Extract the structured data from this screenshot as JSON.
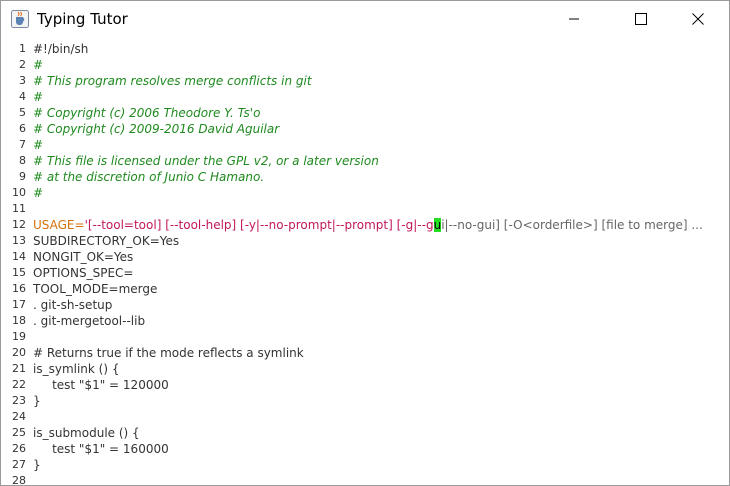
{
  "window": {
    "title": "Typing Tutor",
    "icons": {
      "app": "java-cup-icon",
      "minimize": "minimize-icon",
      "maximize": "maximize-icon",
      "close": "close-icon"
    }
  },
  "editor": {
    "lines": [
      {
        "n": "1",
        "t": "#!/bin/sh",
        "kind": "plain"
      },
      {
        "n": "2",
        "t": "#",
        "kind": "comment"
      },
      {
        "n": "3",
        "t": "# This program resolves merge conflicts in git",
        "kind": "comment"
      },
      {
        "n": "4",
        "t": "#",
        "kind": "comment"
      },
      {
        "n": "5",
        "t": "# Copyright (c) 2006 Theodore Y. Ts'o",
        "kind": "comment"
      },
      {
        "n": "6",
        "t": "# Copyright (c) 2009-2016 David Aguilar",
        "kind": "comment"
      },
      {
        "n": "7",
        "t": "#",
        "kind": "comment"
      },
      {
        "n": "8",
        "t": "# This file is licensed under the GPL v2, or a later version",
        "kind": "comment"
      },
      {
        "n": "9",
        "t": "# at the discretion of Junio C Hamano.",
        "kind": "comment"
      },
      {
        "n": "10",
        "t": "#",
        "kind": "comment"
      },
      {
        "n": "11",
        "t": "",
        "kind": "plain"
      },
      {
        "n": "12",
        "kind": "usage",
        "parts": {
          "var": "USAGE=",
          "str": "'[--tool=tool] [--tool-help] [-y|--no-prompt|--prompt] [-g|--g",
          "cursor": "u",
          "rest": "i|--no-gui] [-O<orderfile>] [file to merge] ..."
        }
      },
      {
        "n": "13",
        "t": "SUBDIRECTORY_OK=Yes",
        "kind": "plain"
      },
      {
        "n": "14",
        "t": "NONGIT_OK=Yes",
        "kind": "plain"
      },
      {
        "n": "15",
        "t": "OPTIONS_SPEC=",
        "kind": "plain"
      },
      {
        "n": "16",
        "t": "TOOL_MODE=merge",
        "kind": "plain"
      },
      {
        "n": "17",
        "t": ". git-sh-setup",
        "kind": "plain"
      },
      {
        "n": "18",
        "t": ". git-mergetool--lib",
        "kind": "plain"
      },
      {
        "n": "19",
        "t": "",
        "kind": "plain"
      },
      {
        "n": "20",
        "t": "# Returns true if the mode reflects a symlink",
        "kind": "plain"
      },
      {
        "n": "21",
        "t": "is_symlink () {",
        "kind": "plain"
      },
      {
        "n": "22",
        "t": "     test \"$1\" = 120000",
        "kind": "plain"
      },
      {
        "n": "23",
        "t": "}",
        "kind": "plain"
      },
      {
        "n": "24",
        "t": "",
        "kind": "plain"
      },
      {
        "n": "25",
        "t": "is_submodule () {",
        "kind": "plain"
      },
      {
        "n": "26",
        "t": "     test \"$1\" = 160000",
        "kind": "plain"
      },
      {
        "n": "27",
        "t": "}",
        "kind": "plain"
      },
      {
        "n": "28",
        "t": "",
        "kind": "plain"
      }
    ]
  }
}
